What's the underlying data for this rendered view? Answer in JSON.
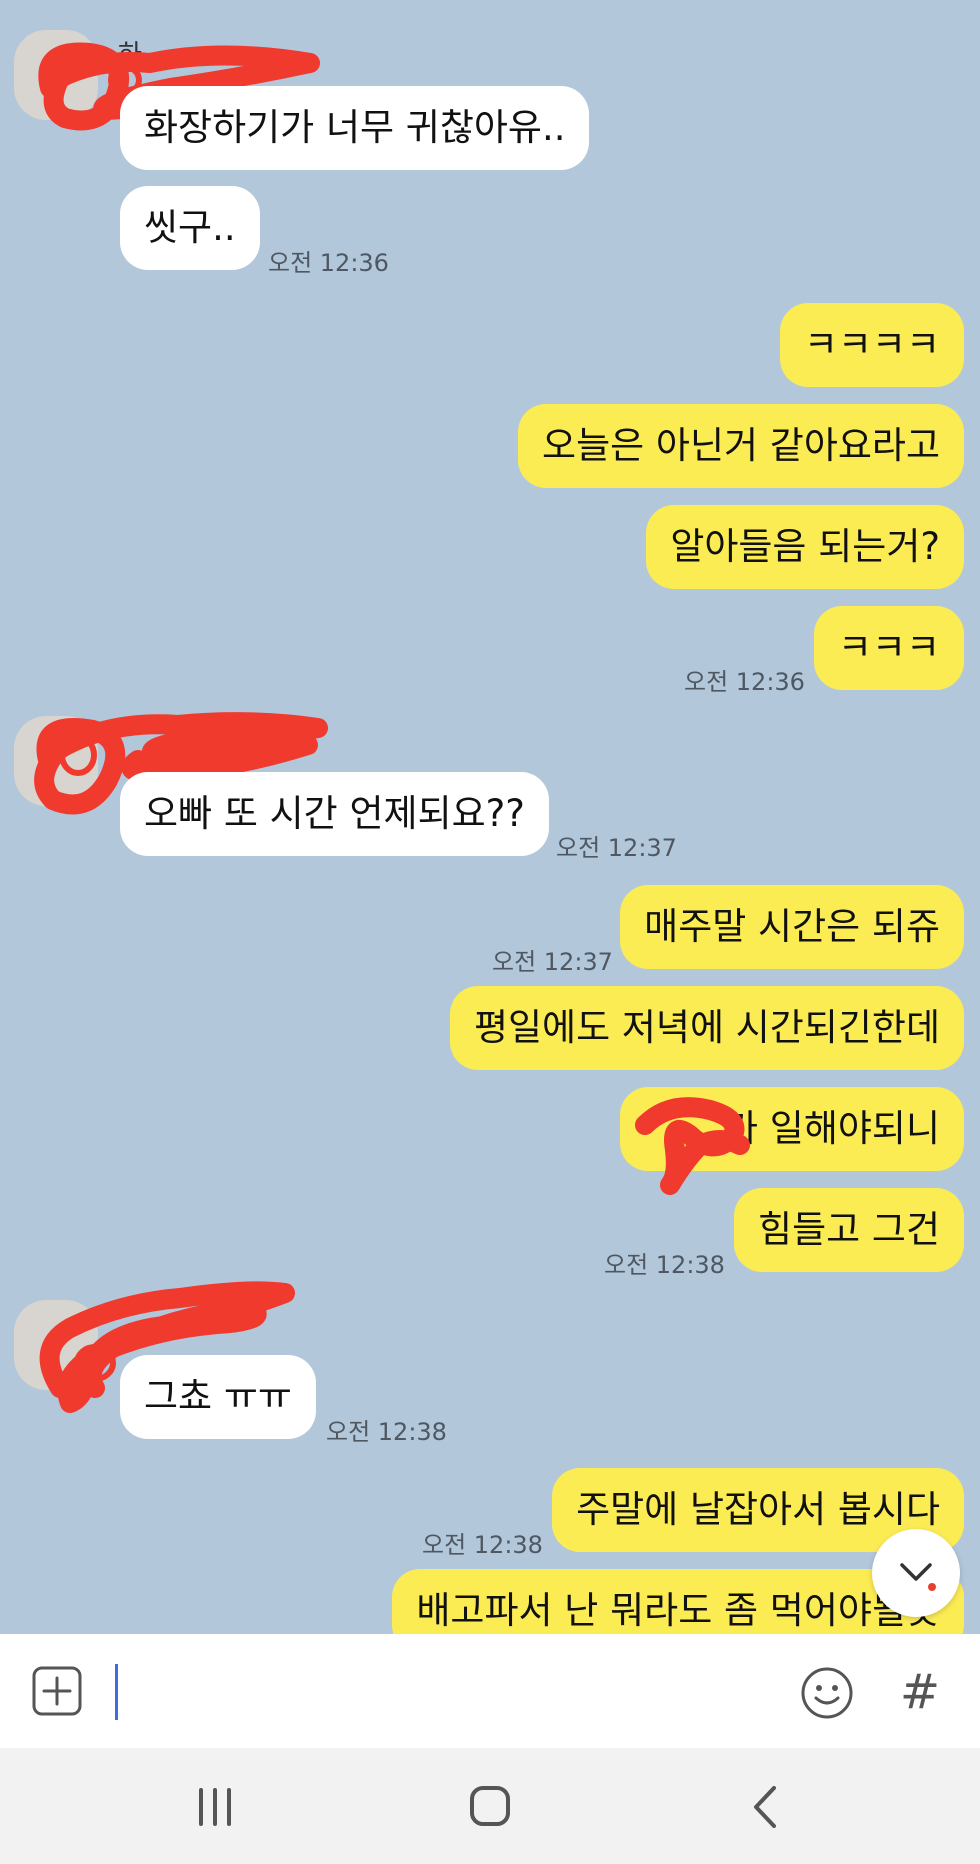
{
  "messages": [
    {
      "text": "화장하기가 너무 귀찮아유..",
      "time": ""
    },
    {
      "text": "씻구..",
      "time": "오전 12:36"
    },
    {
      "text": "ㅋㅋㅋㅋ",
      "time": ""
    },
    {
      "text": "오늘은 아닌거 같아요라고",
      "time": ""
    },
    {
      "text": "알아들음 되는거?",
      "time": ""
    },
    {
      "text": "ㅋㅋㅋ",
      "time": "오전 12:36"
    },
    {
      "text": "오빠 또 시간 언제되요??",
      "time": "오전 12:37"
    },
    {
      "text": "매주말 시간은 되쥬",
      "time": "오전 12:37"
    },
    {
      "text": "평일에도 저녁에 시간되긴한데",
      "time": ""
    },
    {
      "text": "가 일해야되니",
      "time": ""
    },
    {
      "text": "힘들고 그건",
      "time": "오전 12:38"
    },
    {
      "text": "그쵸 ㅠㅠ",
      "time": "오전 12:38"
    },
    {
      "text": "주말에 날잡아서 봅시다",
      "time": "오전 12:38"
    },
    {
      "text": "배고파서 난 뭐라도 좀 먹어야될듯",
      "time": ""
    }
  ],
  "sender_name_fragment": "하",
  "input": {
    "placeholder": "",
    "value": ""
  },
  "icons": {
    "attach": "plus-square-icon",
    "emoji": "smiley-icon",
    "hashtag": "hash-icon",
    "scroll": "chevron-down-icon",
    "nav_recent": "recent-apps-icon",
    "nav_home": "home-icon",
    "nav_back": "back-icon"
  },
  "hash_glyph": "#",
  "colors": {
    "chat_background": "#b2c7da",
    "incoming_bubble": "#ffffff",
    "outgoing_bubble": "#fcec54",
    "redaction": "#f03a2e",
    "caret": "#3a6fd8"
  }
}
